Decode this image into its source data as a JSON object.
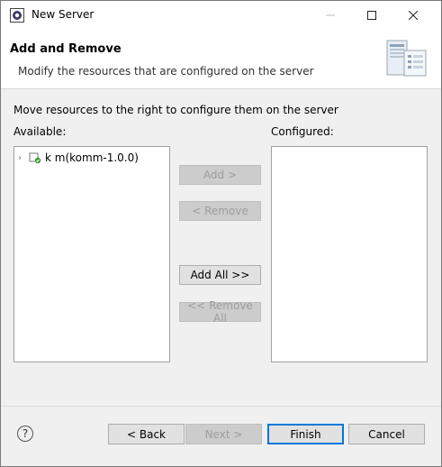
{
  "window": {
    "title": "New Server"
  },
  "banner": {
    "title": "Add and Remove",
    "description": "Modify the resources that are configured on the server"
  },
  "instruction": "Move resources to the right to configure them on the server",
  "available": {
    "label": "Available:",
    "items": [
      {
        "label": "k      m(komm-1.0.0)"
      }
    ]
  },
  "configured": {
    "label": "Configured:",
    "items": []
  },
  "buttons": {
    "add": "Add >",
    "remove": "< Remove",
    "add_all": "Add All >>",
    "remove_all": "<< Remove All",
    "back": "< Back",
    "next": "Next >",
    "finish": "Finish",
    "cancel": "Cancel",
    "help": "?"
  },
  "icons": {
    "app": "eclipse-server-icon",
    "banner": "server-wizard-icon",
    "tree_item": "web-project-icon"
  },
  "colors": {
    "default_button_border": "#0078d7",
    "disabled_text": "#9d9d9d"
  }
}
